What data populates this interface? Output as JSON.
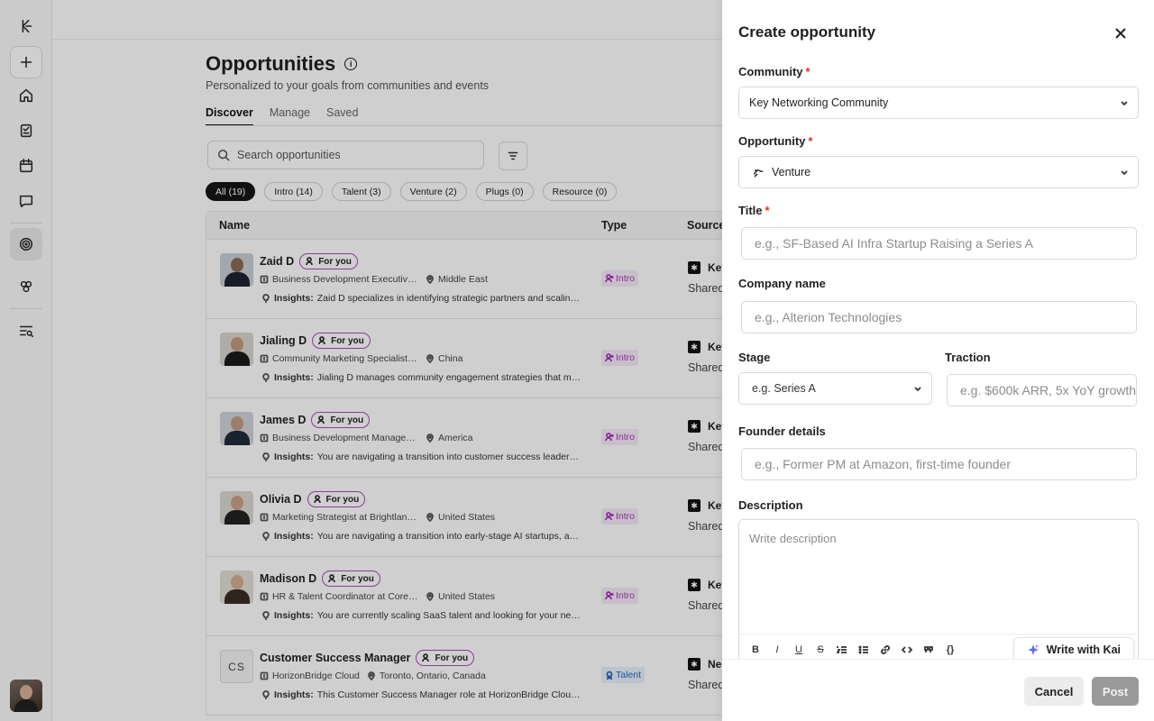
{
  "page": {
    "title": "Opportunities",
    "info_glyph": "i",
    "subtitle": "Personalized to your goals from communities and events",
    "tabs": [
      "Discover",
      "Manage",
      "Saved"
    ],
    "search_placeholder": "Search opportunities",
    "filters": [
      "All (19)",
      "Intro (14)",
      "Talent (3)",
      "Venture (2)",
      "Plugs (0)",
      "Resource (0)"
    ],
    "columns": {
      "name": "Name",
      "type": "Type",
      "source": "Source"
    }
  },
  "rows": [
    {
      "name": "Zaid D",
      "badge": "For you",
      "role": "Business Development Executive ...",
      "location": "Middle East",
      "insight_label": "Insights:",
      "insight": "Zaid D specializes in identifying strategic partners and scaling ...",
      "type": "Intro",
      "source": "Key",
      "shared": "Shared",
      "avatar": {
        "bg": "#c9cfd6",
        "head": "#8a6a55",
        "body": "#1d2430"
      }
    },
    {
      "name": "Jialing D",
      "badge": "For you",
      "role": "Community Marketing Specialist a...",
      "location": "China",
      "insight_label": "Insights:",
      "insight": "Jialing D manages community engagement strategies that mir...",
      "type": "Intro",
      "source": "Key",
      "shared": "Shared",
      "avatar": {
        "bg": "#d9d4cf",
        "head": "#c29a80",
        "body": "#1a1a1a"
      }
    },
    {
      "name": "James D",
      "badge": "For you",
      "role": "Business Development Manager a...",
      "location": "America",
      "insight_label": "Insights:",
      "insight": "You are navigating a transition into customer success leadersh...",
      "type": "Intro",
      "source": "Key",
      "shared": "Shared",
      "avatar": {
        "bg": "#cfd3d8",
        "head": "#c59b82",
        "body": "#1f2a3a"
      }
    },
    {
      "name": "Olivia D",
      "badge": "For you",
      "role": "Marketing Strategist at Brightlane ...",
      "location": "United States",
      "insight_label": "Insights:",
      "insight": "You are navigating a transition into early-stage AI startups, an...",
      "type": "Intro",
      "source": "Key",
      "shared": "Shared",
      "avatar": {
        "bg": "#dcd7d2",
        "head": "#c9a189",
        "body": "#222"
      }
    },
    {
      "name": "Madison D",
      "badge": "For you",
      "role": "HR & Talent Coordinator at CoreVi...",
      "location": "United States",
      "insight_label": "Insights:",
      "insight": "You are currently scaling SaaS talent and looking for your next ...",
      "type": "Intro",
      "source": "Key",
      "shared": "Shared",
      "avatar": {
        "bg": "#e2ddd6",
        "head": "#d2ad8f",
        "body": "#3a2d25"
      }
    },
    {
      "name": "Customer Success Manager",
      "badge": "For you",
      "role": "HorizonBridge Cloud",
      "location": "Toronto, Ontario, Canada",
      "insight_label": "Insights:",
      "insight": "This Customer Success Manager role at HorizonBridge Cloud p...",
      "type": "Talent",
      "source": "Nel",
      "shared": "Shared",
      "initials": "CS"
    }
  ],
  "drawer": {
    "title": "Create opportunity",
    "community_label": "Community",
    "community_value": "Key Networking Community",
    "opportunity_label": "Opportunity",
    "opportunity_value": "Venture",
    "title_label": "Title",
    "title_placeholder": "e.g., SF-Based AI Infra Startup Raising a Series A",
    "company_label": "Company name",
    "company_placeholder": "e.g., Alterion Technologies",
    "stage_label": "Stage",
    "stage_placeholder": "e.g. Series A",
    "traction_label": "Traction",
    "traction_placeholder": "e.g. $600k ARR, 5x YoY growth",
    "founder_label": "Founder details",
    "founder_placeholder": "e.g., Former PM at Amazon, first-time founder",
    "description_label": "Description",
    "description_placeholder": "Write description",
    "toolbar": {
      "bold": "B",
      "italic": "I",
      "underline": "U",
      "strike": "S",
      "braces": "{}"
    },
    "kai_label": "Write with Kai",
    "cancel_label": "Cancel",
    "post_label": "Post",
    "required_mark": "*"
  }
}
